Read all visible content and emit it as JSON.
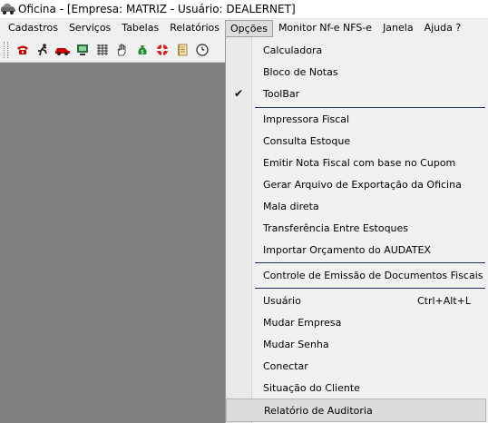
{
  "window": {
    "title": "Oficina - [Empresa: MATRIZ - Usuário: DEALERNET]"
  },
  "menubar": {
    "items": [
      "Cadastros",
      "Serviços",
      "Tabelas",
      "Relatórios",
      "Opções",
      "Monitor Nf-e NFS-e",
      "Janela",
      "Ajuda ?"
    ],
    "active": "Opções"
  },
  "toolbar": {
    "buttons": [
      "phone-icon",
      "running-man-icon",
      "car-icon",
      "computer-icon",
      "grid-icon",
      "hand-icon",
      "money-bag-icon",
      "lifebuoy-icon",
      "notepad-icon",
      "clock-icon"
    ]
  },
  "dropdown": {
    "items": [
      {
        "label": "Calculadora"
      },
      {
        "label": "Bloco de Notas"
      },
      {
        "label": "ToolBar",
        "checked": true
      },
      {
        "label": "Impressora Fiscal"
      },
      {
        "label": "Consulta Estoque"
      },
      {
        "label": "Emitir Nota Fiscal com base no Cupom"
      },
      {
        "label": "Gerar Arquivo de Exportação da Oficina"
      },
      {
        "label": "Mala direta"
      },
      {
        "label": "Transferência Entre Estoques"
      },
      {
        "label": "Importar Orçamento do AUDATEX"
      },
      {
        "label": "Controle de Emissão de Documentos Fiscais"
      },
      {
        "label": "Usuário",
        "shortcut": "Ctrl+Alt+L"
      },
      {
        "label": "Mudar Empresa"
      },
      {
        "label": "Mudar Senha"
      },
      {
        "label": "Conectar"
      },
      {
        "label": "Situação do Cliente"
      },
      {
        "label": "Relatório de Auditoria",
        "highlighted": true
      }
    ]
  },
  "colors": {
    "workspace": "#808080",
    "menu_bg": "#f0f0f0",
    "separator": "#1c2a5a"
  }
}
